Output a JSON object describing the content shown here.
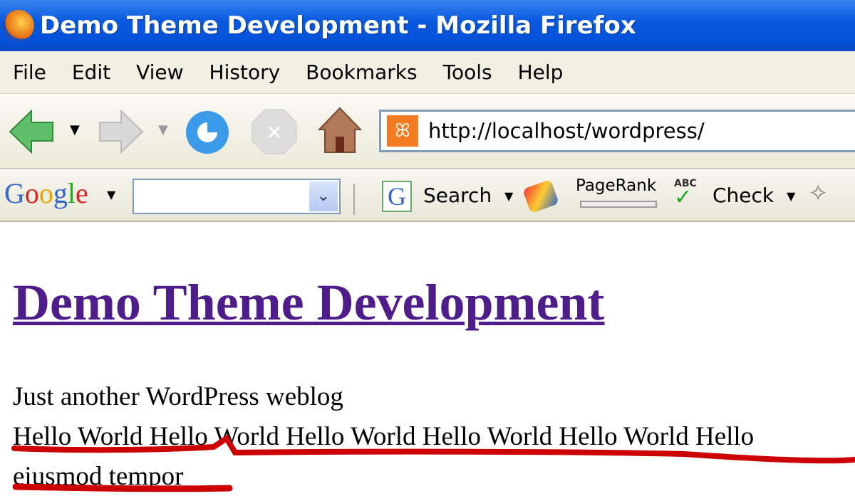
{
  "window": {
    "title": "Demo Theme Development - Mozilla Firefox"
  },
  "menu": [
    "File",
    "Edit",
    "View",
    "History",
    "Bookmarks",
    "Tools",
    "Help"
  ],
  "nav": {
    "url": "http://localhost/wordpress/"
  },
  "google_toolbar": {
    "logo": "Google",
    "search_label": "Search",
    "pagerank_label": "PageRank",
    "check_label": "Check",
    "spell_icon_text": "ABC"
  },
  "page": {
    "heading": "Demo Theme Development",
    "tagline": "Just another WordPress weblog",
    "line1": "Hello World Hello World Hello World Hello World Hello World Hello",
    "line2": "eiusmod tempor"
  },
  "colors": {
    "heading": "#4f1d8b",
    "annotation": "#cc0000",
    "titlebar": "#0552d8"
  }
}
